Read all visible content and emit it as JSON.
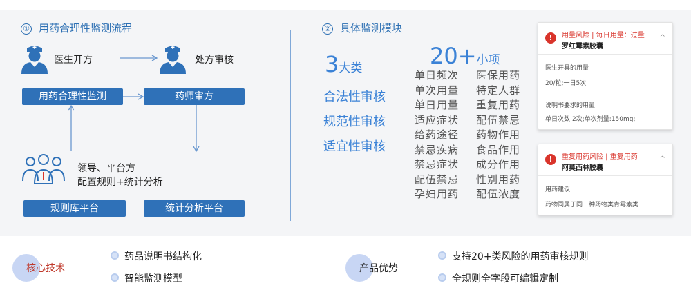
{
  "left_section": {
    "num": "①",
    "title": "用药合理性监测流程",
    "doctor_label": "医生开方",
    "review_label": "处方审核",
    "monitor_box": "用药合理性监测",
    "pharmacist_box": "药师审方",
    "leader_line1": "领导、平台方",
    "leader_line2": "配置规则+统计分析",
    "rules_box": "规则库平台",
    "stats_box": "统计分析平台"
  },
  "middle_section": {
    "num": "②",
    "title": "具体监测模块",
    "cats_num": "3",
    "cats_unit": "大类",
    "items_num": "20+",
    "items_unit": "小项",
    "categories": [
      "合法性审核",
      "规范性审核",
      "适宜性审核"
    ],
    "items_col1": [
      "单日频次",
      "单次用量",
      "单日用量",
      "适应症状",
      "给药途径",
      "禁忌疾病",
      "禁忌症状",
      "配伍禁忌",
      "孕妇用药"
    ],
    "items_col2": [
      "医保用药",
      "特定人群",
      "重复用药",
      "配伍禁忌",
      "药物作用",
      "食品作用",
      "成分作用",
      "性别用药",
      "配伍浓度"
    ]
  },
  "card1": {
    "warn": "!",
    "risk": "用量风险 | 每日用量：过量",
    "drug": "罗红霉素胶囊",
    "chev": "^",
    "row1": "医生开具的用量",
    "row2": "20/粒;一日5次",
    "row3": "说明书要求的用量",
    "row4": "单日次数:2次;单次剂量:150mg;"
  },
  "card2": {
    "warn": "!",
    "risk": "重复用药风险 | 重复用药",
    "drug": "阿莫西林胶囊",
    "chev": "^",
    "row1": "用药建议",
    "row2": "药物同属于同一种药物类青霉素类"
  },
  "bottom": {
    "core_title": "核心技术",
    "core_items": [
      "药品说明书结构化",
      "智能监测模型"
    ],
    "adv_title": "产品优势",
    "adv_items": [
      "支持20+类风险的用药审核规则",
      "全规则全字段可编辑定制"
    ]
  },
  "colors": {
    "accent_blue": "#2f71b8",
    "light_blue": "#3b82d6",
    "warn_red": "#d9342b",
    "core_title_red": "#c0392b"
  },
  "icons": [
    "doctor-icon",
    "pharmacist-icon",
    "team-icon",
    "warning-icon",
    "chevron-up-icon",
    "bullet-icon"
  ]
}
